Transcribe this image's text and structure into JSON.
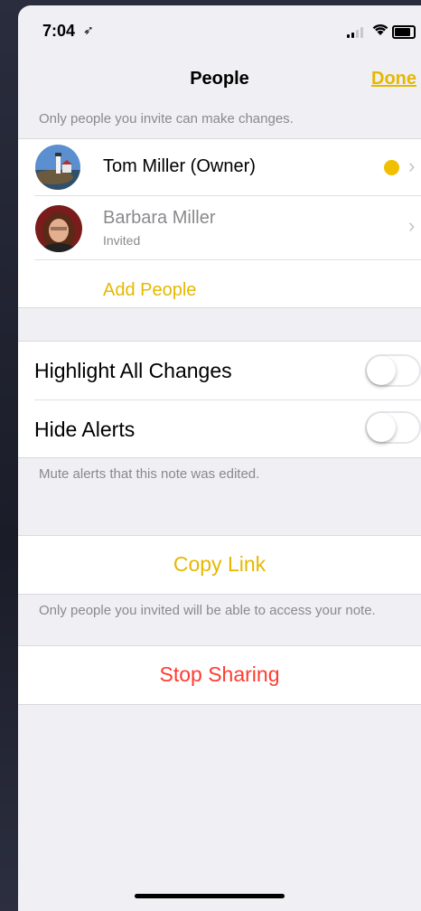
{
  "status_bar": {
    "time": "7:04",
    "location_glyph": "➶"
  },
  "nav": {
    "title": "People",
    "done": "Done"
  },
  "people_note": "Only people you invite can make changes.",
  "people": [
    {
      "name": "Tom Miller (Owner)",
      "status": "",
      "avatar_icon": "lighthouse-photo"
    },
    {
      "name": "Barbara Miller",
      "status": "Invited",
      "avatar_icon": "person-photo"
    }
  ],
  "add_people": "Add People",
  "settings": [
    {
      "label": "Highlight All Changes",
      "on": false
    },
    {
      "label": "Hide Alerts",
      "on": false
    }
  ],
  "alerts_note": "Mute alerts that this note was edited.",
  "copy_link": "Copy Link",
  "access_note": "Only people you invited will be able to access your note.",
  "stop_sharing": "Stop Sharing",
  "colors": {
    "accent": "#e6b800",
    "destructive": "#ff3b30",
    "owner_dot": "#f0c000"
  }
}
